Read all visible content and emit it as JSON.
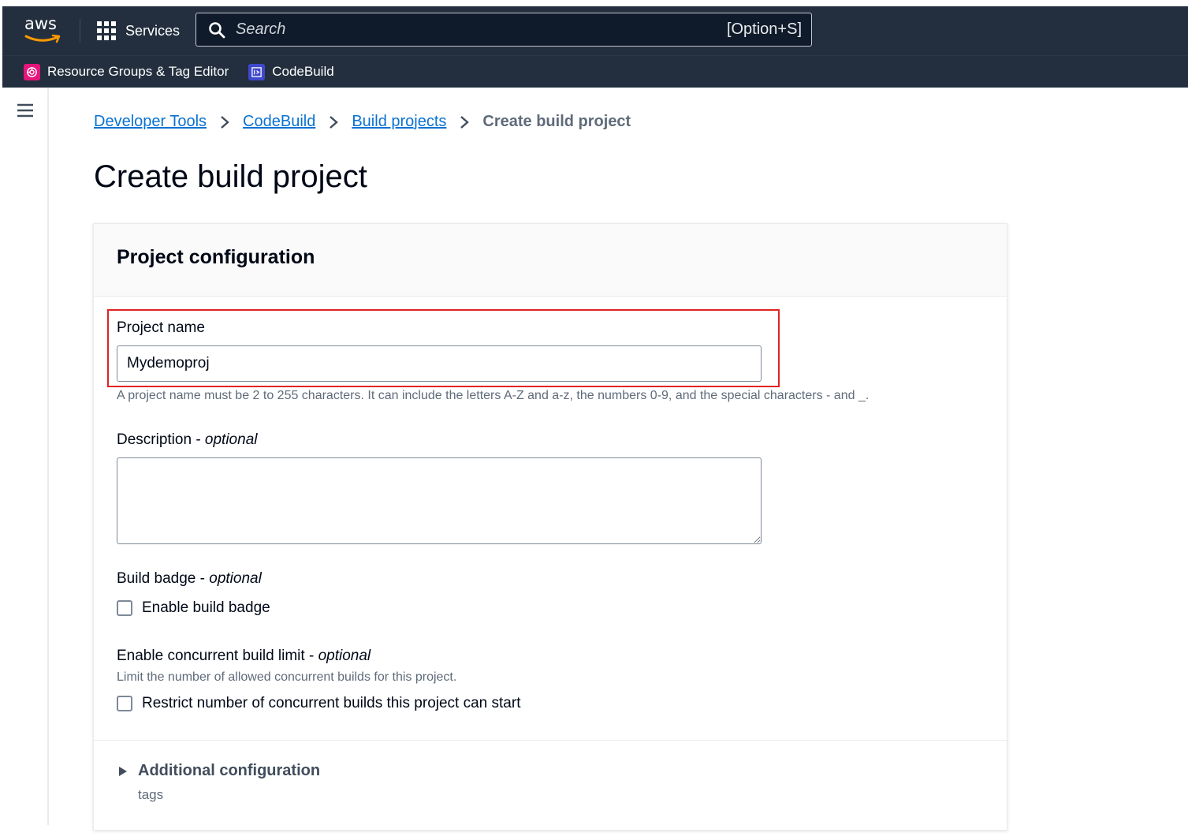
{
  "nav": {
    "logo_text": "aws",
    "services_label": "Services",
    "search_placeholder": "Search",
    "search_shortcut": "[Option+S]",
    "favorites": [
      {
        "label": "Resource Groups & Tag Editor",
        "icon": "resource-groups-icon",
        "color": "#e7157b"
      },
      {
        "label": "CodeBuild",
        "icon": "codebuild-icon",
        "color": "#3f48cc"
      }
    ]
  },
  "breadcrumb": {
    "items": [
      "Developer Tools",
      "CodeBuild",
      "Build projects"
    ],
    "current": "Create build project"
  },
  "page": {
    "title": "Create build project"
  },
  "panel": {
    "title": "Project configuration",
    "project_name": {
      "label": "Project name",
      "value": "Mydemoproj",
      "hint": "A project name must be 2 to 255 characters. It can include the letters A-Z and a-z, the numbers 0-9, and the special characters - and _."
    },
    "description": {
      "label": "Description - ",
      "optional": "optional",
      "value": ""
    },
    "build_badge": {
      "label": "Build badge - ",
      "optional": "optional",
      "checkbox_label": "Enable build badge",
      "checked": false
    },
    "concurrent": {
      "label": "Enable concurrent build limit - ",
      "optional": "optional",
      "hint": "Limit the number of allowed concurrent builds for this project.",
      "checkbox_label": "Restrict number of concurrent builds this project can start",
      "checked": false
    },
    "additional": {
      "label": "Additional configuration",
      "description": "tags"
    }
  },
  "colors": {
    "nav_bg": "#232f3e",
    "link": "#0972d3",
    "highlight": "#e02424"
  }
}
